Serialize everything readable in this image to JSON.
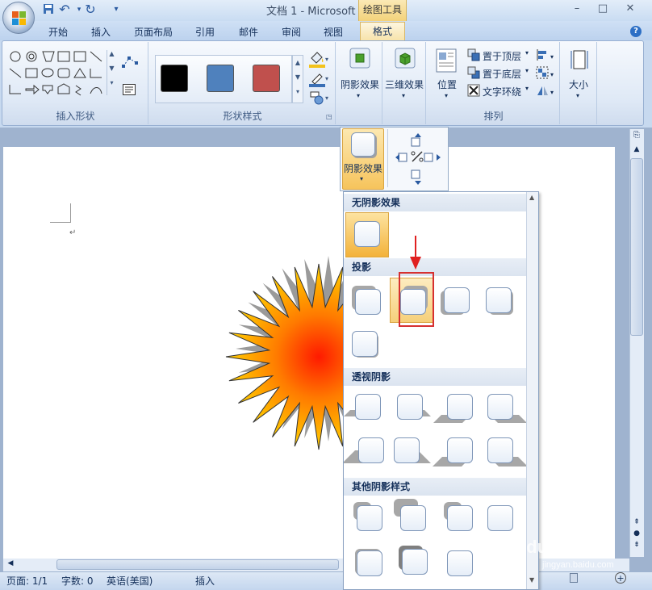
{
  "window": {
    "title": "文档 1 - Microsoft Word",
    "context_tab": "绘图工具",
    "controls": {
      "minimize": "–",
      "maximize": "□",
      "close": "✕"
    }
  },
  "quick_access": {
    "save": "save-icon",
    "undo": "↶",
    "redo": "↻",
    "customize": "▾"
  },
  "tabs": [
    "开始",
    "插入",
    "页面布局",
    "引用",
    "邮件",
    "审阅",
    "视图",
    "格式"
  ],
  "active_tab": "格式",
  "help_label": "?",
  "ribbon": {
    "groups": {
      "insert_shapes": "插入形状",
      "shape_styles": "形状样式",
      "arrange": "排列"
    },
    "swatch_colors": [
      "#000000",
      "#4f81bd",
      "#c0504d"
    ],
    "buttons": {
      "shadow_effect": "阴影效果",
      "threed_effect": "三维效果",
      "position": "位置",
      "bring_to_front": "置于顶层",
      "send_to_back": "置于底层",
      "text_wrap": "文字环绕",
      "size": "大小"
    }
  },
  "popup": {
    "shadow_button": "阴影效果"
  },
  "shadow_menu": {
    "sections": [
      "无阴影效果",
      "投影",
      "透视阴影",
      "其他阴影样式"
    ]
  },
  "status": {
    "page": "页面: 1/1",
    "words": "字数: 0",
    "language": "英语(美国)",
    "mode": "插入"
  },
  "watermark": {
    "line1": "Baidu 经验",
    "line2": "jingyan.baidu.com"
  },
  "colors": {
    "accent": "#f0b030",
    "highlight": "#d63030",
    "ribbon": "#dfe9f6"
  }
}
